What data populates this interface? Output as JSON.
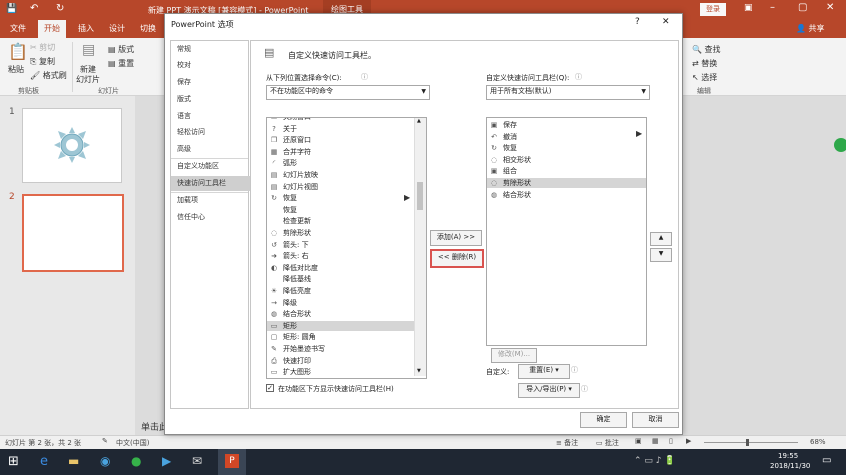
{
  "window": {
    "title": "新建 PPT 演示文稿 [兼容模式] - PowerPoint",
    "context_tab": "绘图工具",
    "login": "登录",
    "share": "共享"
  },
  "ribbon": {
    "tabs": [
      "文件",
      "开始",
      "插入",
      "设计",
      "切换"
    ],
    "clipboard": {
      "paste": "粘贴",
      "cut": "剪切",
      "copy": "复制",
      "format_painter": "格式刷",
      "group": "剪贴板"
    },
    "slides": {
      "new_slide": "新建",
      "new_slide2": "幻灯片",
      "layout": "版式",
      "reset": "重置",
      "group": "幻灯片"
    },
    "editing": {
      "find": "查找",
      "replace": "替换",
      "select": "选择",
      "group": "编辑"
    }
  },
  "thumbnails": [
    {
      "number": "1"
    },
    {
      "number": "2"
    }
  ],
  "canvas_hint": "单击此",
  "status": {
    "slide_info": "幻灯片 第 2 张，共 2 张",
    "language": "中文(中国)",
    "notes": "备注",
    "comments": "批注",
    "zoom": "68%"
  },
  "taskbar": {
    "time": "19:55",
    "date": "2018/11/30"
  },
  "dialog": {
    "title": "PowerPoint 选项",
    "help": "?",
    "close": "✕",
    "nav_items": [
      "常规",
      "校对",
      "保存",
      "版式",
      "语言",
      "轻松访问",
      "高级",
      "自定义功能区",
      "快速访问工具栏",
      "加载项",
      "信任中心"
    ],
    "nav_selected": 8,
    "heading": "自定义快速访问工具栏。",
    "choose_label": "从下列位置选择命令(C):",
    "choose_value": "不在功能区中的命令",
    "customize_label": "自定义快速访问工具栏(Q):",
    "customize_value": "用于所有文档(默认)",
    "left_list": [
      {
        "icon": "▭",
        "label": "关闭窗口"
      },
      {
        "icon": "?",
        "label": "关于"
      },
      {
        "icon": "❐",
        "label": "还原窗口"
      },
      {
        "icon": "▦",
        "label": "合并字符"
      },
      {
        "icon": "◜",
        "label": "弧形"
      },
      {
        "icon": "▤",
        "label": "幻灯片放映"
      },
      {
        "icon": "▤",
        "label": "幻灯片视图"
      },
      {
        "icon": "↻",
        "label": "恢复"
      },
      {
        "icon": "",
        "label": "恢复"
      },
      {
        "icon": "",
        "label": "检查更新"
      },
      {
        "icon": "◌",
        "label": "剪除形状"
      },
      {
        "icon": "↺",
        "label": "箭头: 下"
      },
      {
        "icon": "➜",
        "label": "箭头: 右"
      },
      {
        "icon": "◐",
        "label": "降低对比度"
      },
      {
        "icon": "",
        "label": "降低基线"
      },
      {
        "icon": "☀",
        "label": "降低亮度"
      },
      {
        "icon": "→",
        "label": "降级"
      },
      {
        "icon": "◍",
        "label": "结合形状"
      },
      {
        "icon": "▭",
        "label": "矩形"
      },
      {
        "icon": "▢",
        "label": "矩形: 圆角"
      },
      {
        "icon": "✎",
        "label": "开始墨迹书写"
      },
      {
        "icon": "⎙",
        "label": "快速打印"
      },
      {
        "icon": "▭",
        "label": "扩大图形"
      }
    ],
    "left_selected": 18,
    "right_list": [
      {
        "icon": "▣",
        "label": "保存"
      },
      {
        "icon": "↶",
        "label": "撤消"
      },
      {
        "icon": "↻",
        "label": "恢复"
      },
      {
        "icon": "◌",
        "label": "相交形状"
      },
      {
        "icon": "▣",
        "label": "组合"
      },
      {
        "icon": "◌",
        "label": "剪除形状"
      },
      {
        "icon": "◍",
        "label": "结合形状"
      }
    ],
    "right_selected": 5,
    "add_button": "添加(A) >>",
    "remove_button": "<< 删除(R)",
    "modify_button": "修改(M)...",
    "customize_text": "自定义:",
    "reset_button": "重置(E) ▾",
    "import_button": "导入/导出(P) ▾",
    "show_below_label": "在功能区下方显示快速访问工具栏(H)",
    "ok": "确定",
    "cancel": "取消"
  },
  "colors": {
    "accent": "#b7472a",
    "remove_border": "#d9534f",
    "selection": "#d5d5d5"
  }
}
